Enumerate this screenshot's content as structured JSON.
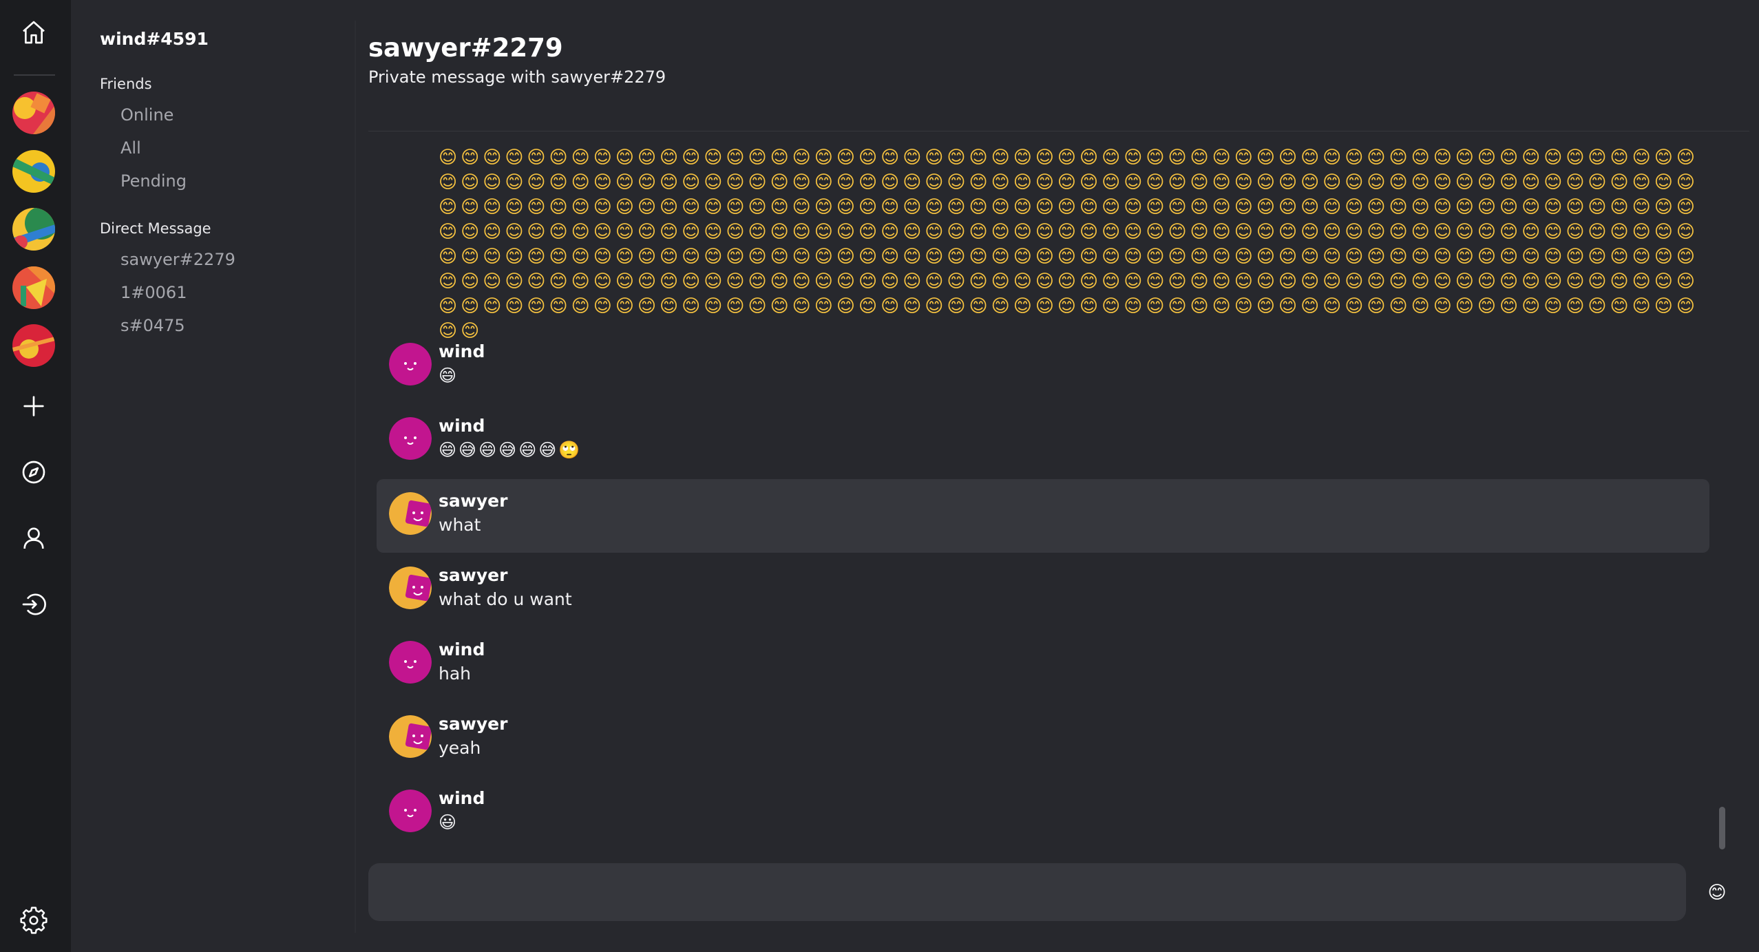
{
  "user": {
    "name": "wind#4591"
  },
  "sidebar": {
    "friends_title": "Friends",
    "friends_items": [
      {
        "label": "Online"
      },
      {
        "label": "All"
      },
      {
        "label": "Pending"
      }
    ],
    "dm_title": "Direct Message",
    "dm_items": [
      {
        "label": "sawyer#2279"
      },
      {
        "label": "1#0061"
      },
      {
        "label": "s#0475"
      }
    ]
  },
  "rail": {
    "icons": [
      "home-icon",
      "add-server-icon",
      "explore-compass-icon",
      "profile-icon",
      "logout-icon",
      "settings-gear-icon"
    ],
    "server_count": 5
  },
  "chat": {
    "title": "sawyer#2279",
    "subtitle": "Private message with sawyer#2279",
    "emoji_block": "😊😊😊😊😊😊😊😊😊😊😊😊😊😊😊😊😊😊😊😊😊😊😊😊😊😊😊😊😊😊😊😊😊😊😊😊😊😊😊😊😊😊😊😊😊😊😊😊😊😊😊😊😊😊😊😊😊😊😊😊😊😊😊😊😊😊😊😊😊😊😊😊😊😊😊😊😊😊😊😊😊😊😊😊😊😊😊😊😊😊😊😊😊😊😊😊😊😊😊😊😊😊😊😊😊😊😊😊😊😊😊😊😊😊😊😊😊😊😊😊😊😊😊😊😊😊😊😊😊😊😊😊😊😊😊😊😊😊😊😊😊😊😊😊😊😊😊😊😊😊😊😊😊😊😊😊😊😊😊😊😊😊😊😊😊😊😊😊😊😊😊😊😊😊😊😊😊😊😊😊😊😊😊😊😊😊😊😊😊😊😊😊😊😊😊😊😊😊😊😊😊😊😊😊😊😊😊😊😊😊😊😊😊😊😊😊😊😊😊😊😊😊😊😊😊😊😊😊😊😊😊😊😊😊😊😊😊😊😊😊😊😊😊😊😊😊😊😊😊😊😊😊😊😊😊😊😊😊😊😊😊😊😊😊😊😊😊😊😊😊😊😊😊😊😊😊😊😊😊😊😊😊😊😊😊😊😊😊😊😊😊😊😊😊😊😊😊😊😊😊😊😊😊😊😊😊😊😊😊😊😊😊😊😊😊😊😊😊😊😊😊😊😊😊😊😊😊😊😊😊😊😊😊😊😊😊😊😊😊😊😊😊😊😊😊😊😊😊😊😊😊😊😊😊😊😊😊😊😊😊😊😊😊😊😊😊😊😊😊😊😊😊😊😊😊😊😊😊😊😊😊😊😊😊😊😊😊😊😊😊😊😊😊😊😊😊😊😊😊😊😊",
    "messages": [
      {
        "author": "wind",
        "content": "😄",
        "avatar": "wind-avatar"
      },
      {
        "author": "wind",
        "content": "😄😅😄😅😄😅🙄",
        "avatar": "wind-avatar"
      },
      {
        "author": "sawyer",
        "content": "what",
        "avatar": "sawyer-avatar",
        "highlighted": true
      },
      {
        "author": "sawyer",
        "content": "what do u want",
        "avatar": "sawyer-avatar"
      },
      {
        "author": "wind",
        "content": "hah",
        "avatar": "wind-avatar"
      },
      {
        "author": "sawyer",
        "content": "yeah",
        "avatar": "sawyer-avatar"
      },
      {
        "author": "wind",
        "content": "😃",
        "avatar": "wind-avatar"
      }
    ],
    "composer": {
      "value": "",
      "placeholder": ""
    },
    "emoji_button": "😊"
  },
  "colors": {
    "rail_bg": "#1b1c1f",
    "panel_bg": "#27282d",
    "message_hover": "#36373d",
    "wind_avatar": "#c2158f",
    "sawyer_avatar_bg": "#f0b03a"
  }
}
